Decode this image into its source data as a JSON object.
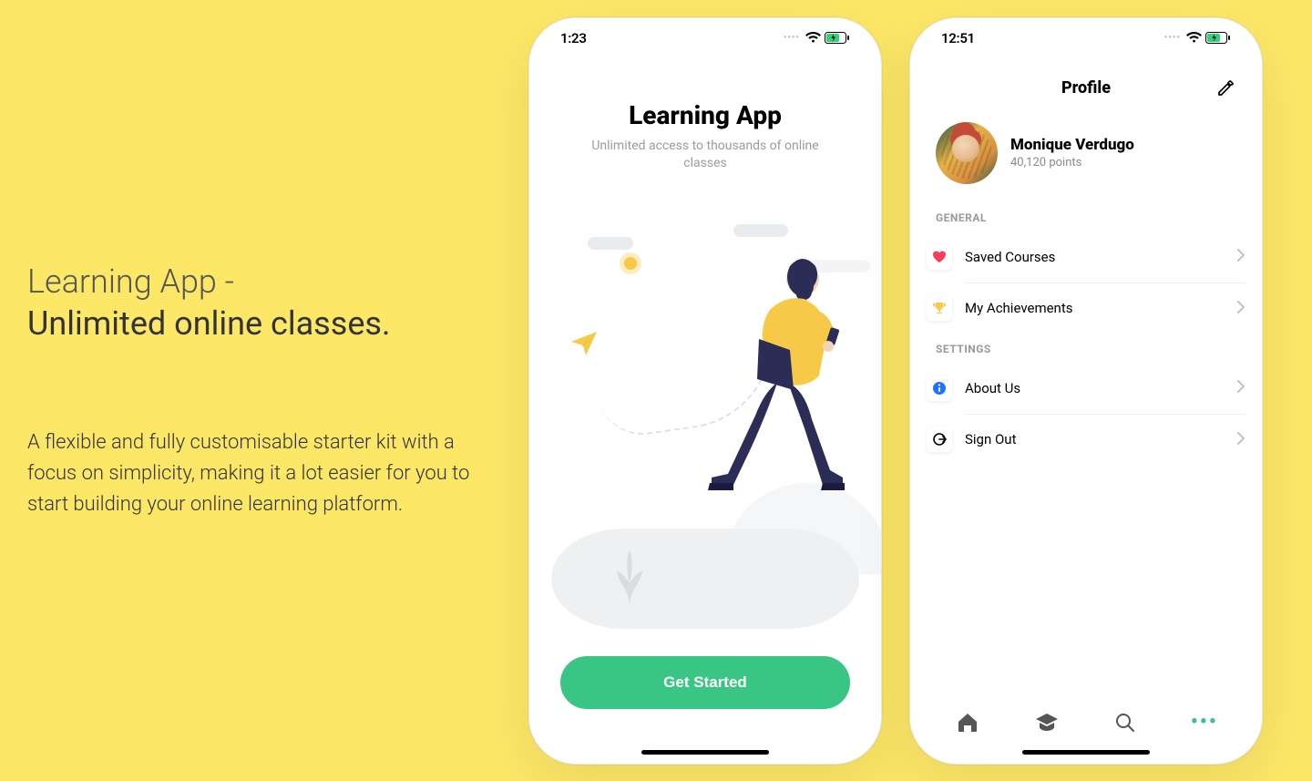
{
  "marketing": {
    "title_line1": "Learning App -",
    "title_line2": "Unlimited online classes.",
    "description": "A flexible and fully customisable starter kit with a focus on simplicity, making it a lot easier for you to start building your online learning platform."
  },
  "phone1": {
    "status_time": "1:23",
    "app_title": "Learning App",
    "app_subtitle": "Unlimited access to thousands of online classes",
    "cta_label": "Get Started"
  },
  "phone2": {
    "status_time": "12:51",
    "header_title": "Profile",
    "user_name": "Monique Verdugo",
    "user_points": "40,120 points",
    "section_general": "GENERAL",
    "section_settings": "SETTINGS",
    "menu": {
      "saved_courses": "Saved Courses",
      "my_achievements": "My Achievements",
      "about_us": "About Us",
      "sign_out": "Sign Out"
    }
  }
}
